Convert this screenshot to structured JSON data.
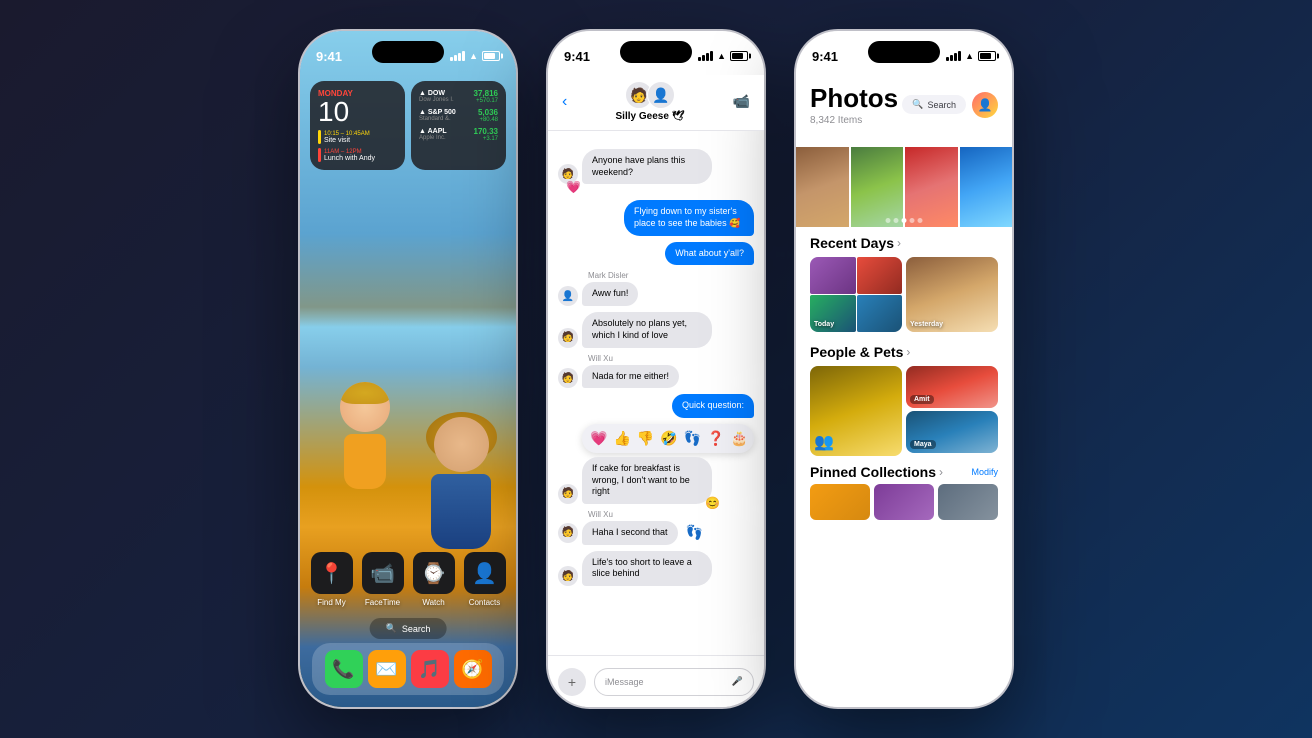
{
  "phone1": {
    "status": {
      "time": "9:41",
      "signal": "●●●",
      "wifi": "wifi",
      "battery": "battery"
    },
    "widgets": {
      "calendar": {
        "day": "Monday",
        "date": "10",
        "events": [
          {
            "time": "10:15 – 10:45AM",
            "title": "Site visit"
          },
          {
            "time": "11AM – 12PM",
            "title": "Lunch with Andy"
          }
        ]
      },
      "stocks": [
        {
          "name": "DOW",
          "sub": "Dow Jones I.",
          "price": "37,816",
          "change": "+570.17"
        },
        {
          "name": "S&P 500",
          "sub": "Standard &.",
          "price": "5,036",
          "change": "+80.48"
        },
        {
          "name": "AAPL",
          "sub": "Apple Inc.",
          "price": "170.33",
          "change": "+3.17"
        }
      ]
    },
    "apps": [
      {
        "name": "Find My",
        "emoji": "📍",
        "color": "#3d9970"
      },
      {
        "name": "FaceTime",
        "emoji": "📹",
        "color": "#1c1c1e"
      },
      {
        "name": "Watch",
        "emoji": "⌚",
        "color": "#1c1c1e"
      },
      {
        "name": "Contacts",
        "emoji": "👤",
        "color": "#1c1c1e"
      }
    ],
    "dock": [
      {
        "emoji": "📞",
        "color": "#30d158"
      },
      {
        "emoji": "✉️",
        "color": "#ff9f0a"
      },
      {
        "emoji": "🎵",
        "color": "#fc3c44"
      },
      {
        "emoji": "🧭",
        "color": "#ff6b00"
      }
    ],
    "search": "Search"
  },
  "phone2": {
    "status": {
      "time": "9:41"
    },
    "header": {
      "back": "‹",
      "group_name": "Silly Geese 🕊",
      "avatar1": "🧑",
      "avatar2": "👤"
    },
    "messages": [
      {
        "type": "received",
        "sender": null,
        "text": "Anyone have plans this weekend?",
        "avatar": "🧑"
      },
      {
        "type": "reaction",
        "emoji": "💗"
      },
      {
        "type": "sent",
        "text": "Flying down to my sister's place to see the babies 🥰"
      },
      {
        "type": "sent",
        "text": "What about y'all?"
      },
      {
        "type": "sender_label",
        "name": "Mark Disler"
      },
      {
        "type": "received",
        "text": "Aww fun!",
        "avatar": "👤"
      },
      {
        "type": "received",
        "text": "Absolutely no plans yet, which I kind of love",
        "avatar": "🧑"
      },
      {
        "type": "sender_label",
        "name": "Will Xu"
      },
      {
        "type": "received",
        "text": "Nada for me either!",
        "avatar": "🧑"
      },
      {
        "type": "sent",
        "text": "Quick question:"
      },
      {
        "type": "emoji_picker",
        "emojis": [
          "💗",
          "👍",
          "👎",
          "🤣",
          "👣",
          "❓",
          "🎂"
        ]
      },
      {
        "type": "received",
        "text": "If cake for breakfast is wrong, I don't want to be right",
        "avatar": "🧑"
      },
      {
        "type": "sender_label",
        "name": "Will Xu"
      },
      {
        "type": "received_with_emoji",
        "text": "Haha I second that",
        "emoji": "👣"
      },
      {
        "type": "received",
        "text": "Life's too short to leave a slice behind",
        "avatar": "🧑"
      }
    ],
    "input": {
      "placeholder": "iMessage",
      "add": "+",
      "mic": "🎤"
    }
  },
  "phone3": {
    "status": {
      "time": "9:41"
    },
    "header": {
      "title": "Photos",
      "count": "8,342 Items",
      "search": "Search"
    },
    "sections": {
      "recent_days": {
        "title": "Recent Days",
        "today": "Today",
        "yesterday": "Yesterday"
      },
      "people_pets": {
        "title": "People & Pets",
        "people": [
          {
            "name": "Amit"
          },
          {
            "name": "Maya"
          }
        ]
      },
      "pinned": {
        "title": "Pinned Collections",
        "modify": "Modify"
      }
    }
  }
}
